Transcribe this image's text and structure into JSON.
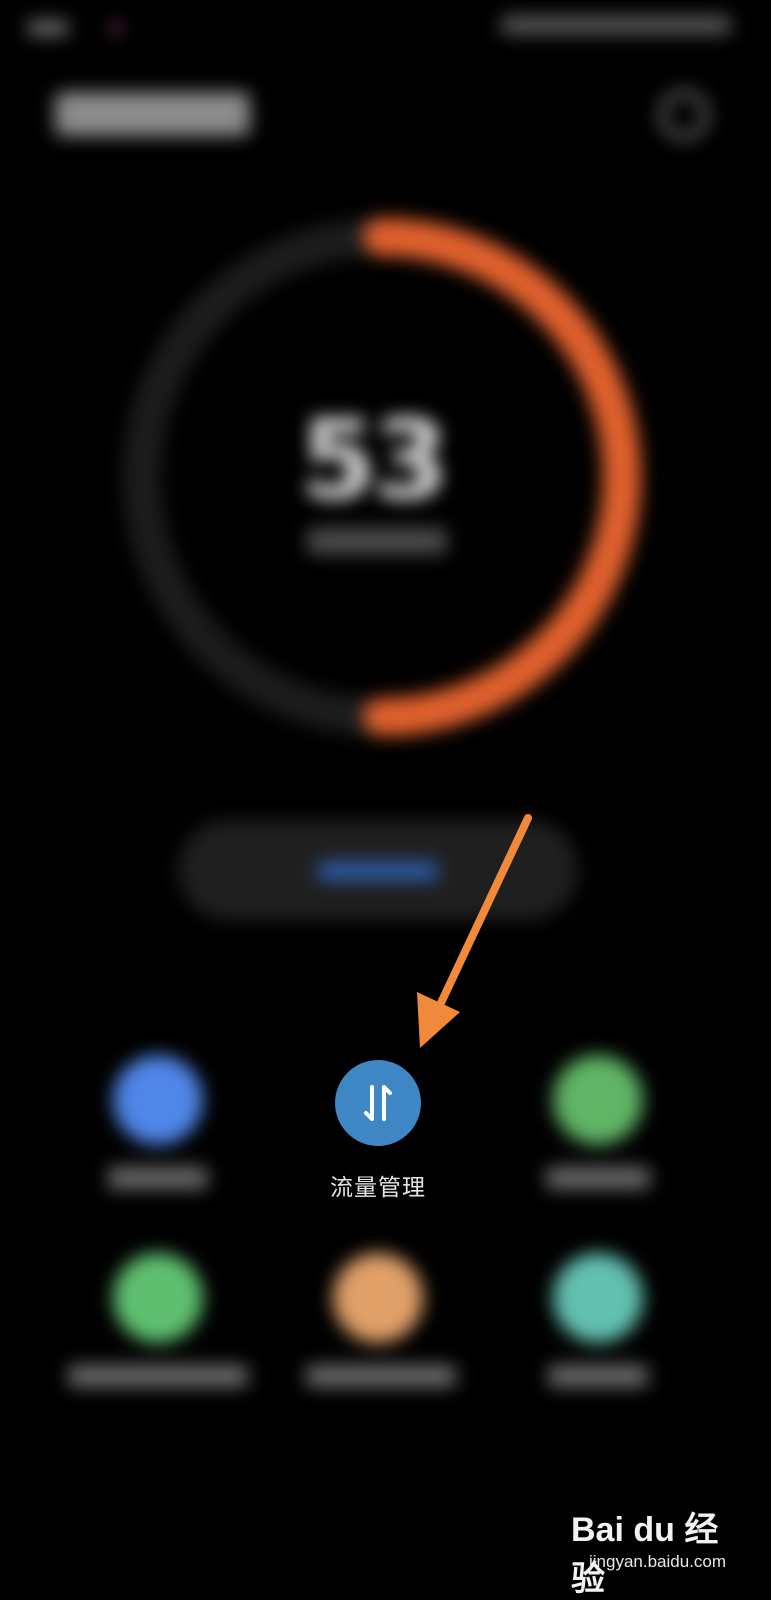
{
  "gauge": {
    "value_display": "53",
    "fill_fraction": 0.5,
    "track_color": "#1c1c1c",
    "fill_color": "#e0612d"
  },
  "tiles": [
    {
      "id": "tile-1",
      "color": "#4f86e8",
      "icon": "blurred-blue-icon"
    },
    {
      "id": "tile-3",
      "color": "#5fb466",
      "icon": "blurred-green-icon"
    },
    {
      "id": "tile-4",
      "color": "#5fbf70",
      "icon": "blurred-green-icon"
    },
    {
      "id": "tile-5",
      "color": "#e0a068",
      "icon": "blurred-orange-icon"
    },
    {
      "id": "tile-6",
      "color": "#62c0b0",
      "icon": "blurred-teal-icon"
    }
  ],
  "traffic": {
    "label": "流量管理",
    "icon": "data-transfer-arrows-icon",
    "color": "#3e87c4"
  },
  "annotation": {
    "arrow_color": "#f08a3a"
  },
  "watermark": {
    "logo_text": "Bai du 经验",
    "sub_text": "jingyan.baidu.com"
  }
}
